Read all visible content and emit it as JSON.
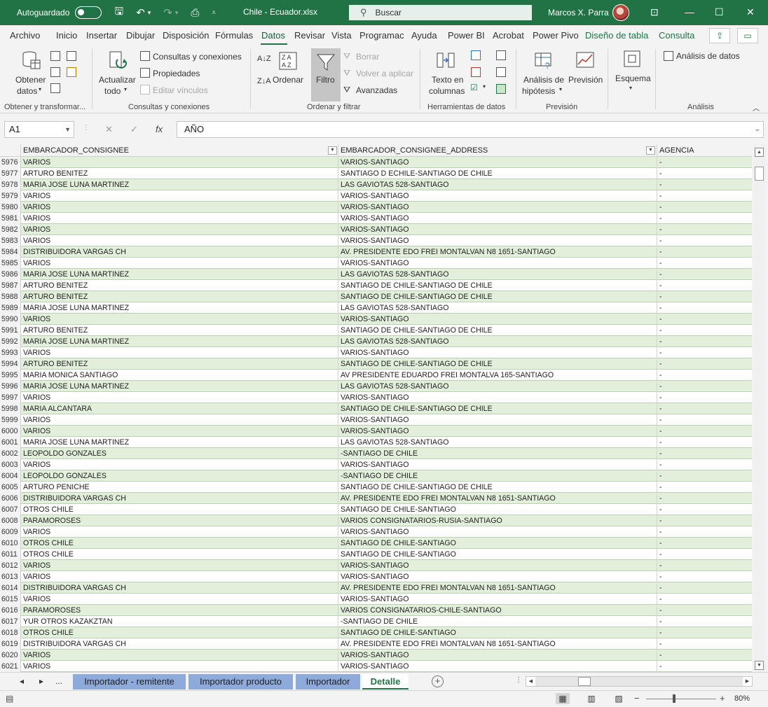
{
  "titlebar": {
    "autosave_label": "Autoguardado",
    "filename": "Chile - Ecuador.xlsx",
    "search_label": "Buscar",
    "user_name": "Marcos X. Parra"
  },
  "menu_tabs": [
    {
      "label": "Archivo"
    },
    {
      "label": "Inicio"
    },
    {
      "label": "Insertar"
    },
    {
      "label": "Dibujar"
    },
    {
      "label": "Disposición"
    },
    {
      "label": "Fórmulas"
    },
    {
      "label": "Datos"
    },
    {
      "label": "Revisar"
    },
    {
      "label": "Vista"
    },
    {
      "label": "Programac"
    },
    {
      "label": "Ayuda"
    },
    {
      "label": "Power BI"
    },
    {
      "label": "Acrobat"
    },
    {
      "label": "Power Pivo"
    },
    {
      "label": "Diseño de tabla"
    },
    {
      "label": "Consulta"
    }
  ],
  "ribbon": {
    "obtener_datos": "Obtener",
    "obtener_datos2": "datos",
    "group1_label": "Obtener y transformar...",
    "actualizar": "Actualizar",
    "actualizar2": "todo",
    "consultas_conexiones": "Consultas y conexiones",
    "propiedades": "Propiedades",
    "editar_vinculos": "Editar vínculos",
    "group2_label": "Consultas y conexiones",
    "ordenar": "Ordenar",
    "filtro": "Filtro",
    "borrar": "Borrar",
    "volver_aplicar": "Volver a aplicar",
    "avanzadas": "Avanzadas",
    "group3_label": "Ordenar y filtrar",
    "texto_columnas": "Texto en",
    "texto_columnas2": "columnas",
    "group4_label": "Herramientas de datos",
    "analisis_hipotesis": "Análisis de",
    "analisis_hipotesis2": "hipótesis",
    "prevision": "Previsión",
    "group5_label": "Previsión",
    "esquema": "Esquema",
    "analisis_datos": "Análisis de datos",
    "group6_label": "Análisis"
  },
  "formula_bar": {
    "name_box": "A1",
    "fx": "fx",
    "value": "AÑO"
  },
  "table": {
    "headers": [
      "EMBARCADOR_CONSIGNEE",
      "EMBARCADOR_CONSIGNEE_ADDRESS",
      "AGENCIA"
    ],
    "rows": [
      {
        "n": "5976",
        "a": "VARIOS",
        "b": "VARIOS-SANTIAGO",
        "c": "-"
      },
      {
        "n": "5977",
        "a": "ARTURO BENITEZ",
        "b": "SANTIAGO D ECHILE-SANTIAGO DE CHILE",
        "c": "-"
      },
      {
        "n": "5978",
        "a": "MARIA JOSE LUNA MARTINEZ",
        "b": "LAS GAVIOTAS 528-SANTIAGO",
        "c": "-"
      },
      {
        "n": "5979",
        "a": "VARIOS",
        "b": "VARIOS-SANTIAGO",
        "c": "-"
      },
      {
        "n": "5980",
        "a": "VARIOS",
        "b": "VARIOS-SANTIAGO",
        "c": "-"
      },
      {
        "n": "5981",
        "a": "VARIOS",
        "b": "VARIOS-SANTIAGO",
        "c": "-"
      },
      {
        "n": "5982",
        "a": "VARIOS",
        "b": "VARIOS-SANTIAGO",
        "c": "-"
      },
      {
        "n": "5983",
        "a": "VARIOS",
        "b": "VARIOS-SANTIAGO",
        "c": "-"
      },
      {
        "n": "5984",
        "a": "DISTRIBUIDORA VARGAS CH",
        "b": "AV. PRESIDENTE EDO FREI MONTALVAN N8 1651-SANTIAGO",
        "c": "-"
      },
      {
        "n": "5985",
        "a": "VARIOS",
        "b": "VARIOS-SANTIAGO",
        "c": "-"
      },
      {
        "n": "5986",
        "a": "MARIA JOSE LUNA MARTINEZ",
        "b": "LAS GAVIOTAS 528-SANTIAGO",
        "c": "-"
      },
      {
        "n": "5987",
        "a": "ARTURO BENITEZ",
        "b": "SANTIAGO DE CHILE-SANTIAGO DE CHILE",
        "c": "-"
      },
      {
        "n": "5988",
        "a": "ARTURO BENITEZ",
        "b": "SANTIAGO DE CHILE-SANTIAGO DE CHILE",
        "c": "-"
      },
      {
        "n": "5989",
        "a": "MARIA JOSE LUNA MARTINEZ",
        "b": "LAS GAVIOTAS 528-SANTIAGO",
        "c": "-"
      },
      {
        "n": "5990",
        "a": "VARIOS",
        "b": "VARIOS-SANTIAGO",
        "c": "-"
      },
      {
        "n": "5991",
        "a": "ARTURO BENITEZ",
        "b": "SANTIAGO DE CHILE-SANTIAGO DE CHILE",
        "c": "-"
      },
      {
        "n": "5992",
        "a": "MARIA JOSE LUNA MARTINEZ",
        "b": "LAS GAVIOTAS 528-SANTIAGO",
        "c": "-"
      },
      {
        "n": "5993",
        "a": "VARIOS",
        "b": "VARIOS-SANTIAGO",
        "c": "-"
      },
      {
        "n": "5994",
        "a": "ARTURO BENITEZ",
        "b": "SANTIAGO DE CHILE-SANTIAGO DE CHILE",
        "c": "-"
      },
      {
        "n": "5995",
        "a": "MARIA MONICA SANTIAGO",
        "b": "AV PRESIDENTE EDUARDO FREI MONTALVA 165-SANTIAGO",
        "c": "-"
      },
      {
        "n": "5996",
        "a": "MARIA JOSE LUNA MARTINEZ",
        "b": "LAS GAVIOTAS 528-SANTIAGO",
        "c": "-"
      },
      {
        "n": "5997",
        "a": "VARIOS",
        "b": "VARIOS-SANTIAGO",
        "c": "-"
      },
      {
        "n": "5998",
        "a": "MARIA ALCANTARA",
        "b": "SANTIAGO DE CHILE-SANTIAGO DE CHILE",
        "c": "-"
      },
      {
        "n": "5999",
        "a": "VARIOS",
        "b": "VARIOS-SANTIAGO",
        "c": "-"
      },
      {
        "n": "6000",
        "a": "VARIOS",
        "b": "VARIOS-SANTIAGO",
        "c": "-"
      },
      {
        "n": "6001",
        "a": "MARIA JOSE LUNA MARTINEZ",
        "b": "LAS GAVIOTAS 528-SANTIAGO",
        "c": "-"
      },
      {
        "n": "6002",
        "a": "LEOPOLDO GONZALES",
        "b": "-SANTIAGO DE CHILE",
        "c": "-"
      },
      {
        "n": "6003",
        "a": "VARIOS",
        "b": "VARIOS-SANTIAGO",
        "c": "-"
      },
      {
        "n": "6004",
        "a": "LEOPOLDO GONZALES",
        "b": "-SANTIAGO DE CHILE",
        "c": "-"
      },
      {
        "n": "6005",
        "a": "ARTURO PENICHE",
        "b": "SANTIAGO DE CHILE-SANTIAGO DE CHILE",
        "c": "-"
      },
      {
        "n": "6006",
        "a": "DISTRIBUIDORA VARGAS CH",
        "b": "AV. PRESIDENTE EDO FREI MONTALVAN N8 1651-SANTIAGO",
        "c": "-"
      },
      {
        "n": "6007",
        "a": "OTROS CHILE",
        "b": "SANTIAGO DE CHILE-SANTIAGO",
        "c": "-"
      },
      {
        "n": "6008",
        "a": "PARAMOROSES",
        "b": "VARIOS CONSIGNATARIOS-RUSIA-SANTIAGO",
        "c": "-"
      },
      {
        "n": "6009",
        "a": "VARIOS",
        "b": "VARIOS-SANTIAGO",
        "c": "-"
      },
      {
        "n": "6010",
        "a": "OTROS CHILE",
        "b": "SANTIAGO DE CHILE-SANTIAGO",
        "c": "-"
      },
      {
        "n": "6011",
        "a": "OTROS CHILE",
        "b": "SANTIAGO DE CHILE-SANTIAGO",
        "c": "-"
      },
      {
        "n": "6012",
        "a": "VARIOS",
        "b": "VARIOS-SANTIAGO",
        "c": "-"
      },
      {
        "n": "6013",
        "a": "VARIOS",
        "b": "VARIOS-SANTIAGO",
        "c": "-"
      },
      {
        "n": "6014",
        "a": "DISTRIBUIDORA VARGAS CH",
        "b": "AV. PRESIDENTE EDO FREI MONTALVAN N8 1651-SANTIAGO",
        "c": "-"
      },
      {
        "n": "6015",
        "a": "VARIOS",
        "b": "VARIOS-SANTIAGO",
        "c": "-"
      },
      {
        "n": "6016",
        "a": "PARAMOROSES",
        "b": "VARIOS CONSIGNATARIOS-CHILE-SANTIAGO",
        "c": "-"
      },
      {
        "n": "6017",
        "a": "YUR OTROS KAZAKZTAN",
        "b": "-SANTIAGO DE CHILE",
        "c": "-"
      },
      {
        "n": "6018",
        "a": "OTROS CHILE",
        "b": "SANTIAGO DE CHILE-SANTIAGO",
        "c": "-"
      },
      {
        "n": "6019",
        "a": "DISTRIBUIDORA VARGAS CH",
        "b": "AV. PRESIDENTE EDO FREI MONTALVAN N8 1651-SANTIAGO",
        "c": "-"
      },
      {
        "n": "6020",
        "a": "VARIOS",
        "b": "VARIOS-SANTIAGO",
        "c": "-"
      },
      {
        "n": "6021",
        "a": "VARIOS",
        "b": "VARIOS-SANTIAGO",
        "c": "-"
      }
    ]
  },
  "sheets": {
    "ellipsis": "...",
    "tabs": [
      "Importador - remitente",
      "Importador producto",
      "Importador",
      "Detalle"
    ]
  },
  "status": {
    "zoom": "80%"
  },
  "colors": {
    "accent": "#217346",
    "band": "#e2efda",
    "tab_inactive": "#8eaadb"
  }
}
